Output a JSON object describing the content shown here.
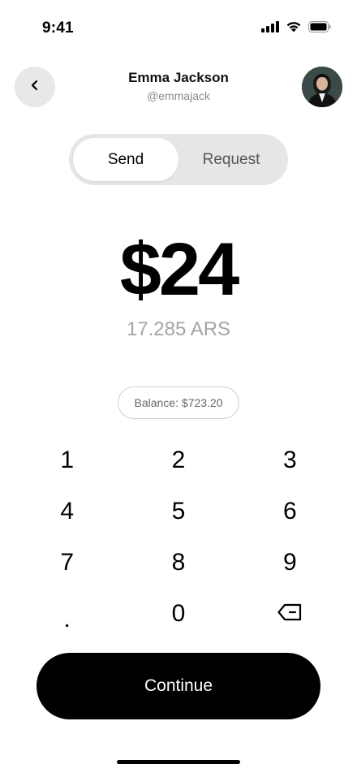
{
  "status_bar": {
    "time": "9:41",
    "icons": [
      "cellular-signal-icon",
      "wifi-icon",
      "battery-icon"
    ]
  },
  "header": {
    "back_icon": "chevron-left-icon",
    "contact_name": "Emma Jackson",
    "contact_handle": "@emmajack",
    "avatar": "avatar-photo"
  },
  "segmented_control": {
    "options": [
      {
        "label": "Send",
        "selected": true
      },
      {
        "label": "Request",
        "selected": false
      }
    ]
  },
  "amount": {
    "value": "$24",
    "converted": "17.285 ARS"
  },
  "balance": {
    "label": "Balance: $723.20"
  },
  "keypad": {
    "keys": [
      "1",
      "2",
      "3",
      "4",
      "5",
      "6",
      "7",
      "8",
      "9",
      ".",
      "0",
      "backspace"
    ],
    "backspace_icon": "backspace-icon"
  },
  "continue_button": {
    "label": "Continue"
  },
  "colors": {
    "background": "#ffffff",
    "primary": "#000000",
    "muted_text": "#a5a5a5",
    "pill_bg": "#e6e6e6"
  }
}
